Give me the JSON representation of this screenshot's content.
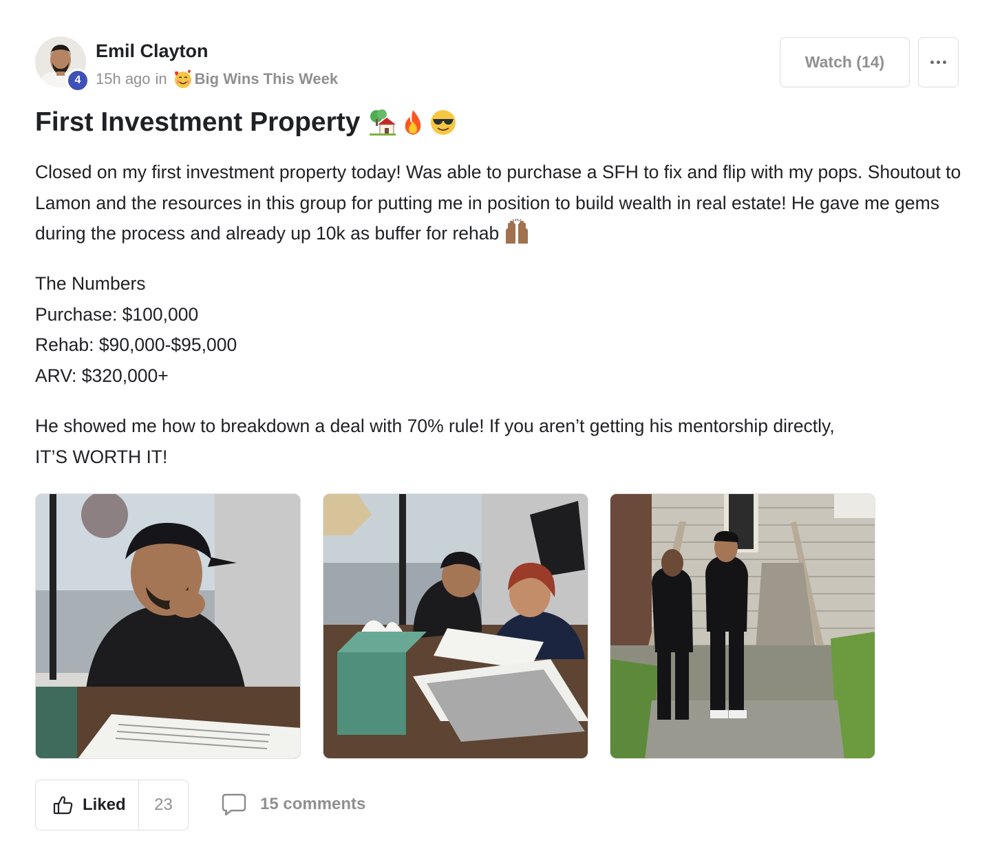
{
  "author": {
    "name": "Emil Clayton",
    "level": "4",
    "time_ago": "15h ago",
    "in_label": "in",
    "category": "Big Wins This Week",
    "category_icon": "smiling-face-with-hearts-emoji"
  },
  "actions": {
    "watch_label": "Watch (14)",
    "more_icon": "more-horizontal-icon"
  },
  "post": {
    "title": "First Investment Property",
    "title_emojis": [
      "house-with-garden-emoji",
      "fire-emoji",
      "smiling-face-with-sunglasses-emoji"
    ],
    "paragraph1": "Closed on my first investment property today! Was able to purchase a SFH to fix and flip with my pops. Shoutout to Lamon and the resources in this group for putting me in position to build wealth in real estate! He gave me gems during the process and already up 10k as buffer for rehab",
    "paragraph1_emoji": "raising-hands-emoji",
    "numbers_heading": "The Numbers",
    "purchase": "Purchase: $100,000",
    "rehab": "Rehab: $90,000-$95,000",
    "arv": "ARV: $320,000+",
    "paragraph3_line1": "He showed me how to breakdown a deal with 70% rule! If you aren’t getting his mentorship directly,",
    "paragraph3_line2": "IT’S WORTH IT!"
  },
  "photos": [
    {
      "subject": "man in LA cap signing papers at office desk"
    },
    {
      "subject": "two people reviewing documents at desk with tissue box"
    },
    {
      "subject": "two men standing in front of house with wooden stairs"
    }
  ],
  "footer": {
    "like_label": "Liked",
    "like_count": "23",
    "like_icon": "thumbs-up-icon",
    "comments_label": "15 comments",
    "comments_icon": "comment-icon"
  },
  "colors": {
    "text": "#202124",
    "muted": "#909090",
    "border": "#dcdcdc",
    "badge": "#3f51b5"
  }
}
